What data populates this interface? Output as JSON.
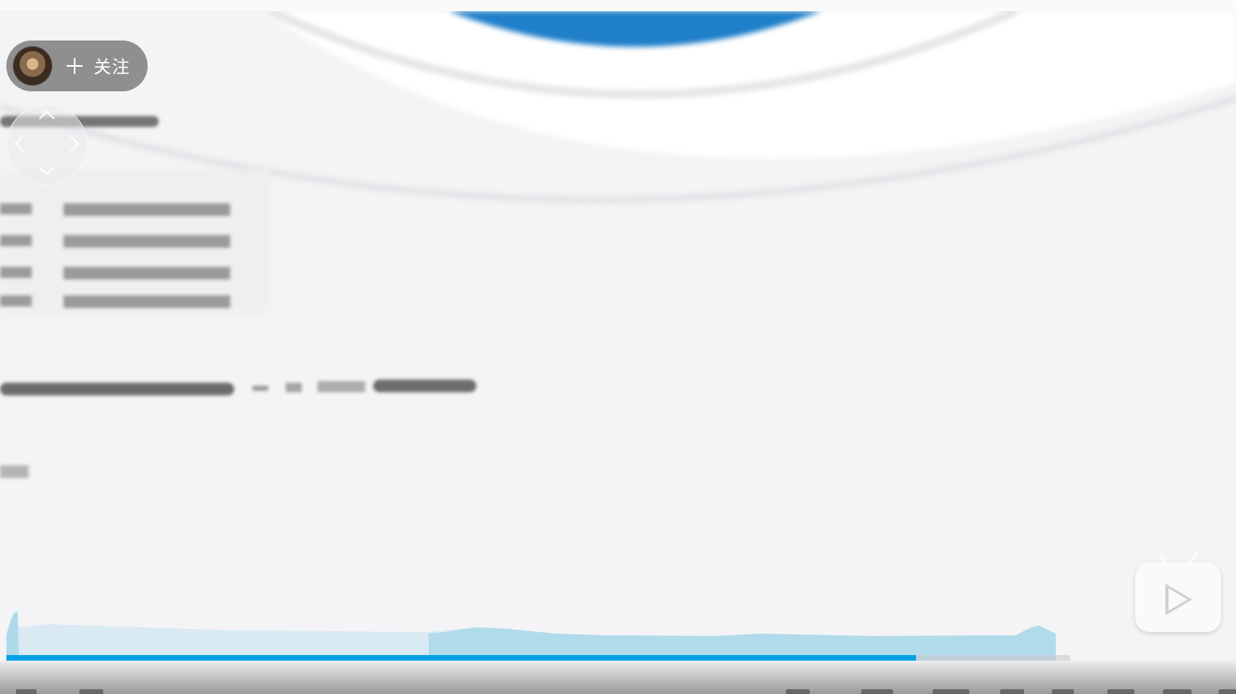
{
  "uploader": {
    "follow_label": "关注"
  },
  "icons": {
    "follow": "plus-icon",
    "avatar": "dog-avatar",
    "dpad": [
      "chevron-up-icon",
      "chevron-down-icon",
      "chevron-left-icon",
      "chevron-right-icon"
    ],
    "tv": "bilibili-tv-play-icon"
  },
  "playback": {
    "progress": 0.855
  },
  "colors": {
    "accent": "#00a1e6",
    "heatmap": "#a9d8ea",
    "overlay": "#505050"
  }
}
